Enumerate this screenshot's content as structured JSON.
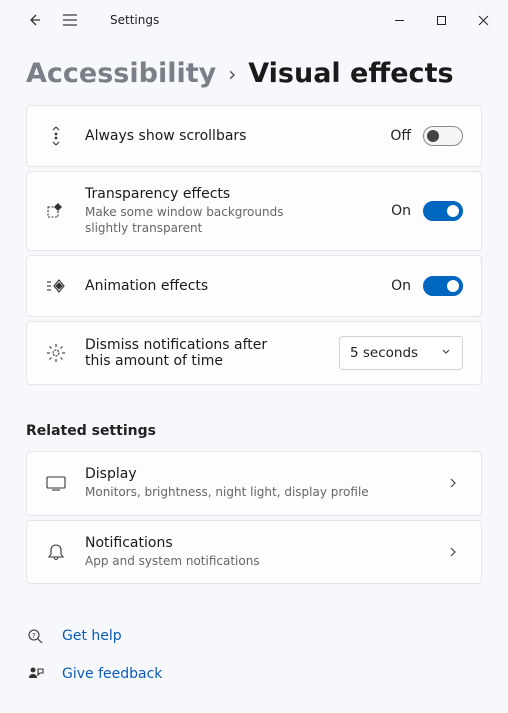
{
  "app": {
    "title": "Settings"
  },
  "breadcrumb": {
    "parent": "Accessibility",
    "separator": "›",
    "current": "Visual effects"
  },
  "rows": {
    "scrollbars": {
      "title": "Always show scrollbars",
      "state_label": "Off",
      "on": false
    },
    "transparency": {
      "title": "Transparency effects",
      "sub": "Make some window backgrounds slightly transparent",
      "state_label": "On",
      "on": true
    },
    "animation": {
      "title": "Animation effects",
      "state_label": "On",
      "on": true
    },
    "dismiss": {
      "title": "Dismiss notifications after this amount of time",
      "value": "5 seconds"
    }
  },
  "related": {
    "header": "Related settings",
    "display": {
      "title": "Display",
      "sub": "Monitors, brightness, night light, display profile"
    },
    "notifications": {
      "title": "Notifications",
      "sub": "App and system notifications"
    }
  },
  "help": {
    "get_help": "Get help",
    "feedback": "Give feedback"
  }
}
